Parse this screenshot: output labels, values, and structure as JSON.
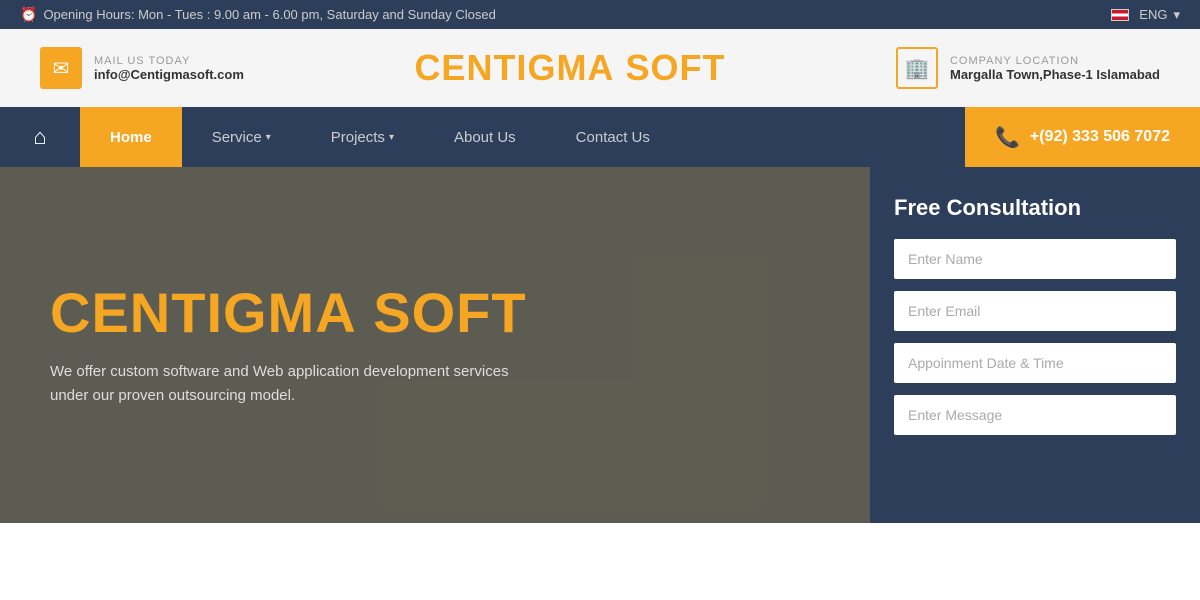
{
  "topbar": {
    "opening_hours": "Opening Hours: Mon - Tues : 9.00 am - 6.00 pm, Saturday and Sunday Closed",
    "language": "ENG"
  },
  "header": {
    "mail_label": "MAIL US TODAY",
    "mail_value": "info@Centigmasoft.com",
    "logo_part1": "CENTIGMA",
    "logo_part2": "SOFT",
    "location_label": "COMPANY LOCATION",
    "location_value": "Margalla Town,Phase-1 Islamabad"
  },
  "navbar": {
    "home_label": "Home",
    "service_label": "Service",
    "projects_label": "Projects",
    "about_label": "About Us",
    "contact_label": "Contact Us",
    "phone": "+(92) 333 506 7072"
  },
  "hero": {
    "title_part1": "CENTIGMA",
    "title_part2": "SOFT",
    "subtitle": "We offer custom software and Web application development services\nunder our proven outsourcing model."
  },
  "consultation": {
    "title": "Free Consultation",
    "name_placeholder": "Enter Name",
    "email_placeholder": "Enter Email",
    "appointment_placeholder": "Appoinment Date & Time",
    "message_placeholder": "Enter Message"
  }
}
